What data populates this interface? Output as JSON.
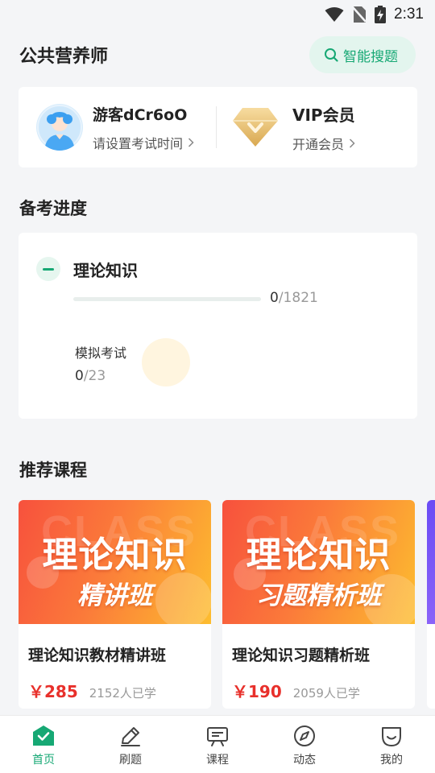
{
  "status_bar": {
    "time": "2:31"
  },
  "header": {
    "title": "公共营养师",
    "search_label": "智能搜题"
  },
  "profile": {
    "user_name": "游客dCr6oO",
    "user_sub": "请设置考试时间",
    "vip_title": "VIP会员",
    "vip_sub": "开通会员"
  },
  "progress_section": {
    "title": "备考进度",
    "subject": "理论知识",
    "done": "0",
    "total": "/1821",
    "progress": 0,
    "mock_label": "模拟考试",
    "mock_done": "0",
    "mock_total": "/23"
  },
  "courses_section": {
    "title": "推荐课程",
    "items": [
      {
        "banner_main": "理论知识",
        "banner_sub": "精讲班",
        "ghost": "CLASS",
        "name": "理论知识教材精讲班",
        "price": "￥285",
        "students": "2152人已学"
      },
      {
        "banner_main": "理论知识",
        "banner_sub": "习题精析班",
        "ghost": "CLASS",
        "name": "理论知识习题精析班",
        "price": "￥190",
        "students": "2059人已学"
      }
    ]
  },
  "tabs": [
    {
      "label": "首页",
      "icon": "home-icon",
      "active": true
    },
    {
      "label": "刷题",
      "icon": "pencil-icon",
      "active": false
    },
    {
      "label": "课程",
      "icon": "course-board-icon",
      "active": false
    },
    {
      "label": "动态",
      "icon": "compass-icon",
      "active": false
    },
    {
      "label": "我的",
      "icon": "profile-icon",
      "active": false
    }
  ],
  "colors": {
    "accent": "#16a874",
    "price": "#e8302b",
    "background": "#f4f5f7"
  }
}
